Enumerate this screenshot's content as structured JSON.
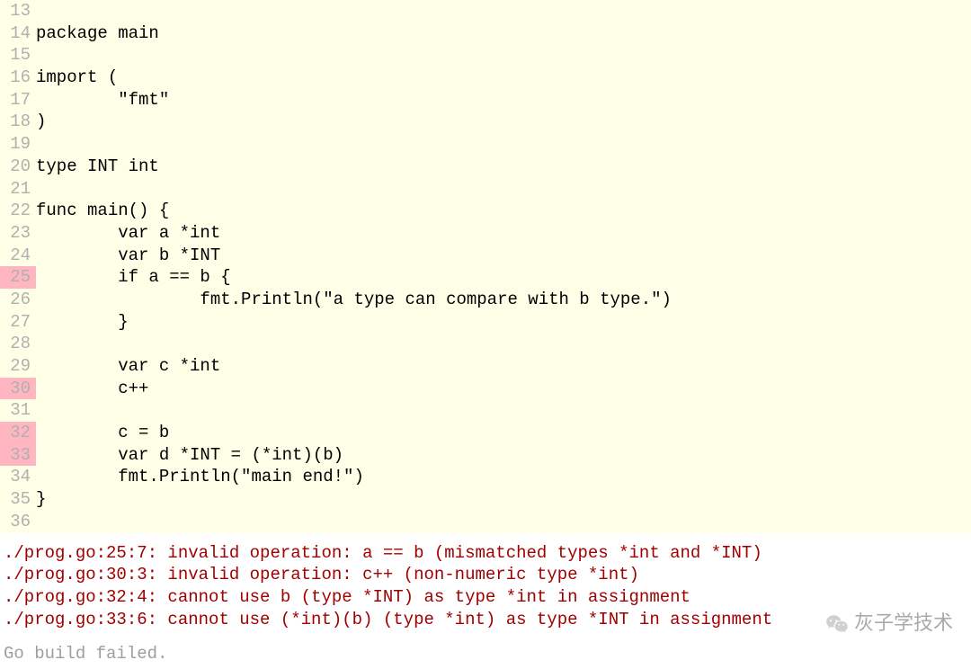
{
  "editor": {
    "lines": [
      {
        "num": "13",
        "err": false,
        "text": ""
      },
      {
        "num": "14",
        "err": false,
        "text": "package main"
      },
      {
        "num": "15",
        "err": false,
        "text": ""
      },
      {
        "num": "16",
        "err": false,
        "text": "import ("
      },
      {
        "num": "17",
        "err": false,
        "text": "        \"fmt\""
      },
      {
        "num": "18",
        "err": false,
        "text": ")"
      },
      {
        "num": "19",
        "err": false,
        "text": ""
      },
      {
        "num": "20",
        "err": false,
        "text": "type INT int"
      },
      {
        "num": "21",
        "err": false,
        "text": ""
      },
      {
        "num": "22",
        "err": false,
        "text": "func main() {"
      },
      {
        "num": "23",
        "err": false,
        "text": "        var a *int"
      },
      {
        "num": "24",
        "err": false,
        "text": "        var b *INT"
      },
      {
        "num": "25",
        "err": true,
        "text": "        if a == b {"
      },
      {
        "num": "26",
        "err": false,
        "text": "                fmt.Println(\"a type can compare with b type.\")"
      },
      {
        "num": "27",
        "err": false,
        "text": "        }"
      },
      {
        "num": "28",
        "err": false,
        "text": ""
      },
      {
        "num": "29",
        "err": false,
        "text": "        var c *int"
      },
      {
        "num": "30",
        "err": true,
        "text": "        c++"
      },
      {
        "num": "31",
        "err": false,
        "text": ""
      },
      {
        "num": "32",
        "err": true,
        "text": "        c = b"
      },
      {
        "num": "33",
        "err": true,
        "text": "        var d *INT = (*int)(b)"
      },
      {
        "num": "34",
        "err": false,
        "text": "        fmt.Println(\"main end!\")"
      },
      {
        "num": "35",
        "err": false,
        "text": "}"
      },
      {
        "num": "36",
        "err": false,
        "text": ""
      }
    ]
  },
  "output": {
    "errors": [
      "./prog.go:25:7: invalid operation: a == b (mismatched types *int and *INT)",
      "./prog.go:30:3: invalid operation: c++ (non-numeric type *int)",
      "./prog.go:32:4: cannot use b (type *INT) as type *int in assignment",
      "./prog.go:33:6: cannot use (*int)(b) (type *int) as type *INT in assignment"
    ],
    "build_status": "Go build failed."
  },
  "watermark": {
    "text": "灰子学技术"
  }
}
